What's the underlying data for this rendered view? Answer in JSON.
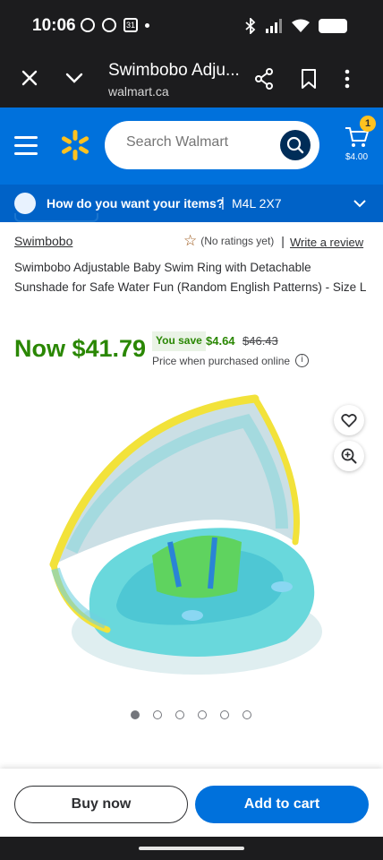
{
  "status_bar": {
    "time": "10:06",
    "calendar_badge": "31",
    "icons": [
      "whatsapp-icon",
      "chat-icon",
      "calendar-icon",
      "bluetooth-icon",
      "signal-icon",
      "wifi-icon",
      "battery-icon"
    ]
  },
  "browser": {
    "title": "Swimbobo Adju...",
    "url": "walmart.ca"
  },
  "header": {
    "search_placeholder": "Search Walmart",
    "cart_count": "1",
    "cart_total": "$4.00",
    "brand_color": "#0071dc",
    "spark_color": "#ffc220"
  },
  "delivery": {
    "question": "How do you want your items?",
    "separator": "|",
    "postal_code": "M4L 2X7"
  },
  "product": {
    "brand": "Swimbobo",
    "ratings": "(No ratings yet)",
    "ratings_separator": "|",
    "write_review": "Write a review",
    "title": "Swimbobo Adjustable Baby Swim Ring with Detachable Sunshade for Safe Water Fun (Random English Patterns) - Size L",
    "price_now": "Now $41.79",
    "you_save_label": "You save",
    "save_amount": "$4.64",
    "was_price": "$46.43",
    "price_note": "Price when purchased online",
    "price_color": "#2a8703",
    "image_count": 6,
    "active_image": 1
  },
  "actions": {
    "buy_now": "Buy now",
    "add_to_cart": "Add to cart"
  }
}
